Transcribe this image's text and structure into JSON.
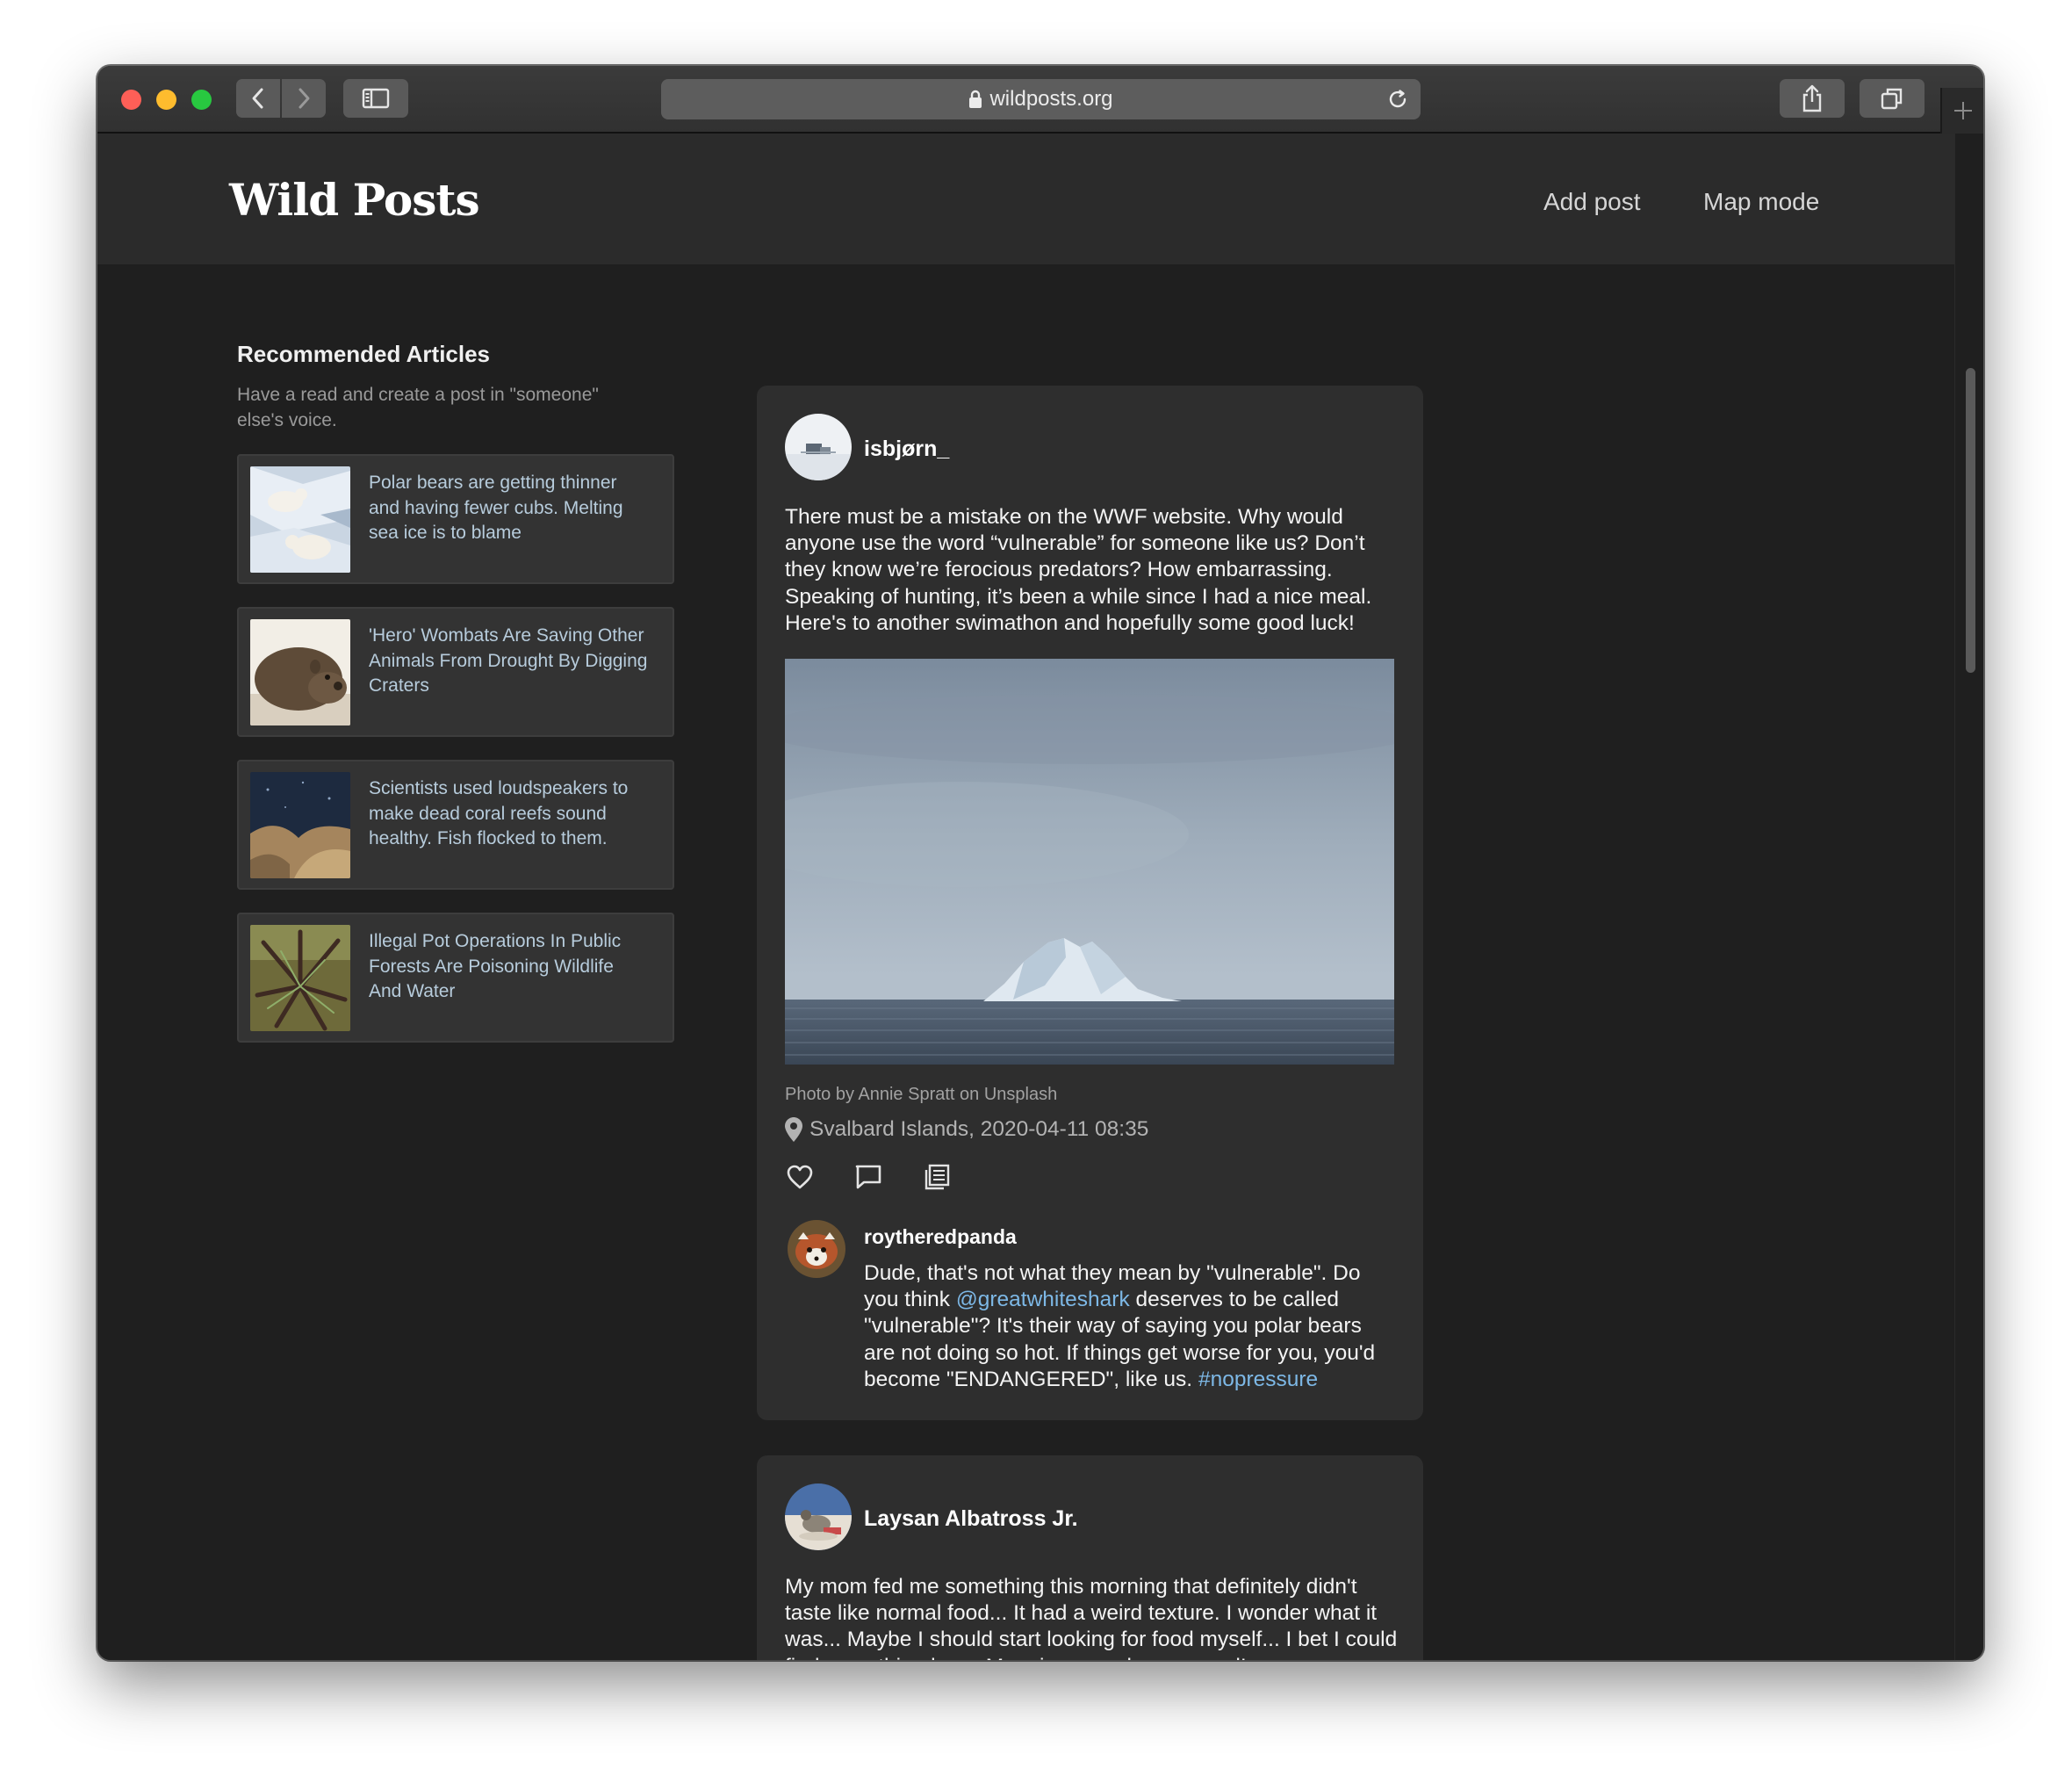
{
  "browser": {
    "url": "wildposts.org",
    "icons": [
      "back-icon",
      "forward-icon",
      "sidebar-icon",
      "lock-icon",
      "reload-icon",
      "share-icon",
      "tabs-icon",
      "plus-icon"
    ]
  },
  "site": {
    "logo": "Wild Posts",
    "nav": {
      "add_post": "Add post",
      "map_mode": "Map mode"
    }
  },
  "sidebar": {
    "title": "Recommended Articles",
    "subtitle": "Have a read and create a post in \"someone\" else's voice.",
    "articles": [
      {
        "title": "Polar bears are getting thinner and having fewer cubs. Melting sea ice is to blame"
      },
      {
        "title": "'Hero' Wombats Are Saving Other Animals From Drought By Digging Craters"
      },
      {
        "title": "Scientists used loudspeakers to make dead coral reefs sound healthy. Fish flocked to them."
      },
      {
        "title": "Illegal Pot Operations In Public Forests Are Poisoning Wildlife And Water"
      }
    ]
  },
  "posts": [
    {
      "username": "isbjørn_",
      "text": "There must be a mistake on the WWF website. Why would anyone use the word “vulnerable” for someone like us? Don’t they know we’re ferocious predators? How embarrassing. Speaking of hunting, it’s been a while since I had a nice meal. Here's to another swimathon and hopefully some good luck!",
      "photo_credit": "Photo by Annie Spratt on Unsplash",
      "location": "Svalbard Islands, 2020-04-11 08:35",
      "comment": {
        "username": "roytheredpanda",
        "text_1": "Dude, that's not what they mean by \"vulnerable\". Do you think ",
        "mention": "@greatwhiteshark",
        "text_2": " deserves to be called \"vulnerable\"? It's their way of saying you polar bears are not doing so hot. If things get worse for you, you'd become \"ENDANGERED\", like us. ",
        "hashtag": "#nopressure"
      }
    },
    {
      "username": "Laysan Albatross Jr.",
      "text": "My mom fed me something this morning that definitely didn't taste like normal food... It had a weird texture. I wonder what it was... Maybe I should start looking for food myself... I bet I could find something here. Mom is gonna be so proud!"
    }
  ],
  "colors": {
    "page_bg": "#1f1f1f",
    "header_bg": "#2b2b2b",
    "card_bg": "#2e2e2e",
    "link": "#7db8e6",
    "article_text": "#b7ccdc"
  }
}
